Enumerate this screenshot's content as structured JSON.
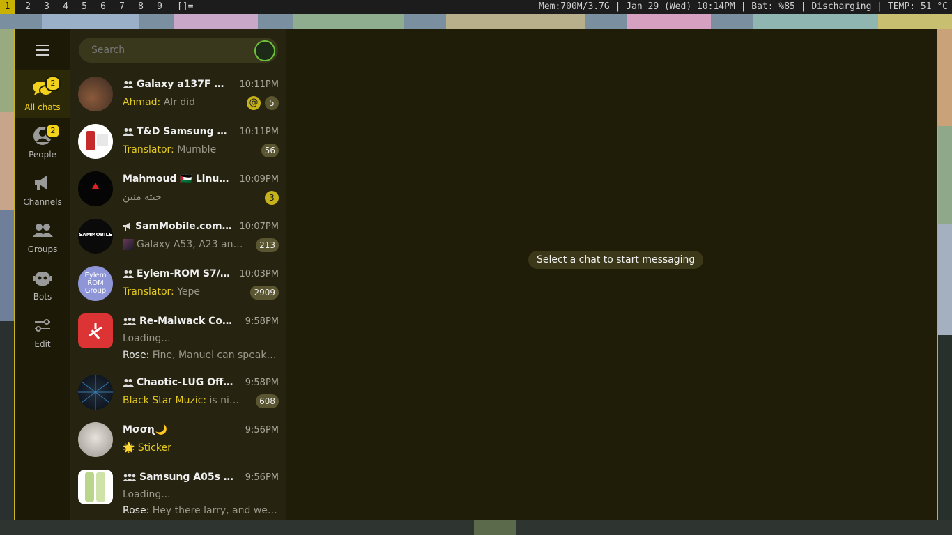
{
  "topbar": {
    "workspaces": [
      "1",
      "2",
      "3",
      "4",
      "5",
      "6",
      "7",
      "8",
      "9"
    ],
    "active_workspace": "1",
    "layout": "[]=",
    "status": "Mem:700M/3.7G | Jan 29 (Wed) 10:14PM | Bat: %85 | Discharging | TEMP: 51 °C"
  },
  "sidebar": {
    "items": [
      {
        "label": "All chats",
        "badge": "2",
        "icon": "chats-icon"
      },
      {
        "label": "People",
        "badge": "2",
        "icon": "person-icon"
      },
      {
        "label": "Channels",
        "icon": "megaphone-icon"
      },
      {
        "label": "Groups",
        "icon": "group-icon"
      },
      {
        "label": "Bots",
        "icon": "bot-icon"
      },
      {
        "label": "Edit",
        "icon": "filter-edit-icon"
      }
    ]
  },
  "search": {
    "placeholder": "Search"
  },
  "chats": [
    {
      "title": "Galaxy a137F 🇵🇸...",
      "time": "10:11PM",
      "sender": "Ahmad:",
      "text": "Alr did",
      "badge": "5",
      "mention": "@",
      "type": "group"
    },
    {
      "title": "T&D Samsung Gal...",
      "time": "10:11PM",
      "sender": "Translator:",
      "text": "Mumble",
      "badge": "56",
      "type": "group"
    },
    {
      "title": "Mahmoud 🇵🇸 Linux u...",
      "time": "10:09PM",
      "text": "حبته منين",
      "badge": "3",
      "type": "person"
    },
    {
      "title": "SamMobile.com - S...",
      "time": "10:07PM",
      "text": "Galaxy A53, A23 and m...",
      "badge": "213",
      "type": "channel",
      "avatar_text": "SAMMOBILE"
    },
    {
      "title": "Eylem-ROM S7/S7E...",
      "time": "10:03PM",
      "sender": "Translator:",
      "text": "Yepe",
      "badge": "2909",
      "type": "group",
      "avatar_text": "Eylem ROM Group"
    },
    {
      "title": "Re-Malwack Comm...",
      "time": "9:58PM",
      "text": "Loading...",
      "sender2": "Rose:",
      "text2": "Fine, Manuel can speak ag...",
      "type": "forum"
    },
    {
      "title": "Chaotic-LUG Offtopi...",
      "time": "9:58PM",
      "sender": "Black Star Muzic:",
      "text": "is nix zed...",
      "badge": "608",
      "type": "group"
    },
    {
      "title": "Μσσɳ🌙",
      "time": "9:56PM",
      "text": "🌟 Sticker",
      "type": "person"
    },
    {
      "title": "Samsung A05s Indo...",
      "time": "9:56PM",
      "text": "Loading...",
      "sender2": "Rose:",
      "text2": "Hey there larry, and welco...",
      "type": "forum"
    }
  ],
  "main": {
    "hint": "Select a chat to start messaging"
  },
  "colors": {
    "accent": "#f2d21b",
    "window_bg": "#1f1d08",
    "list_bg": "#262410",
    "badge_muted": "#5a5631"
  }
}
